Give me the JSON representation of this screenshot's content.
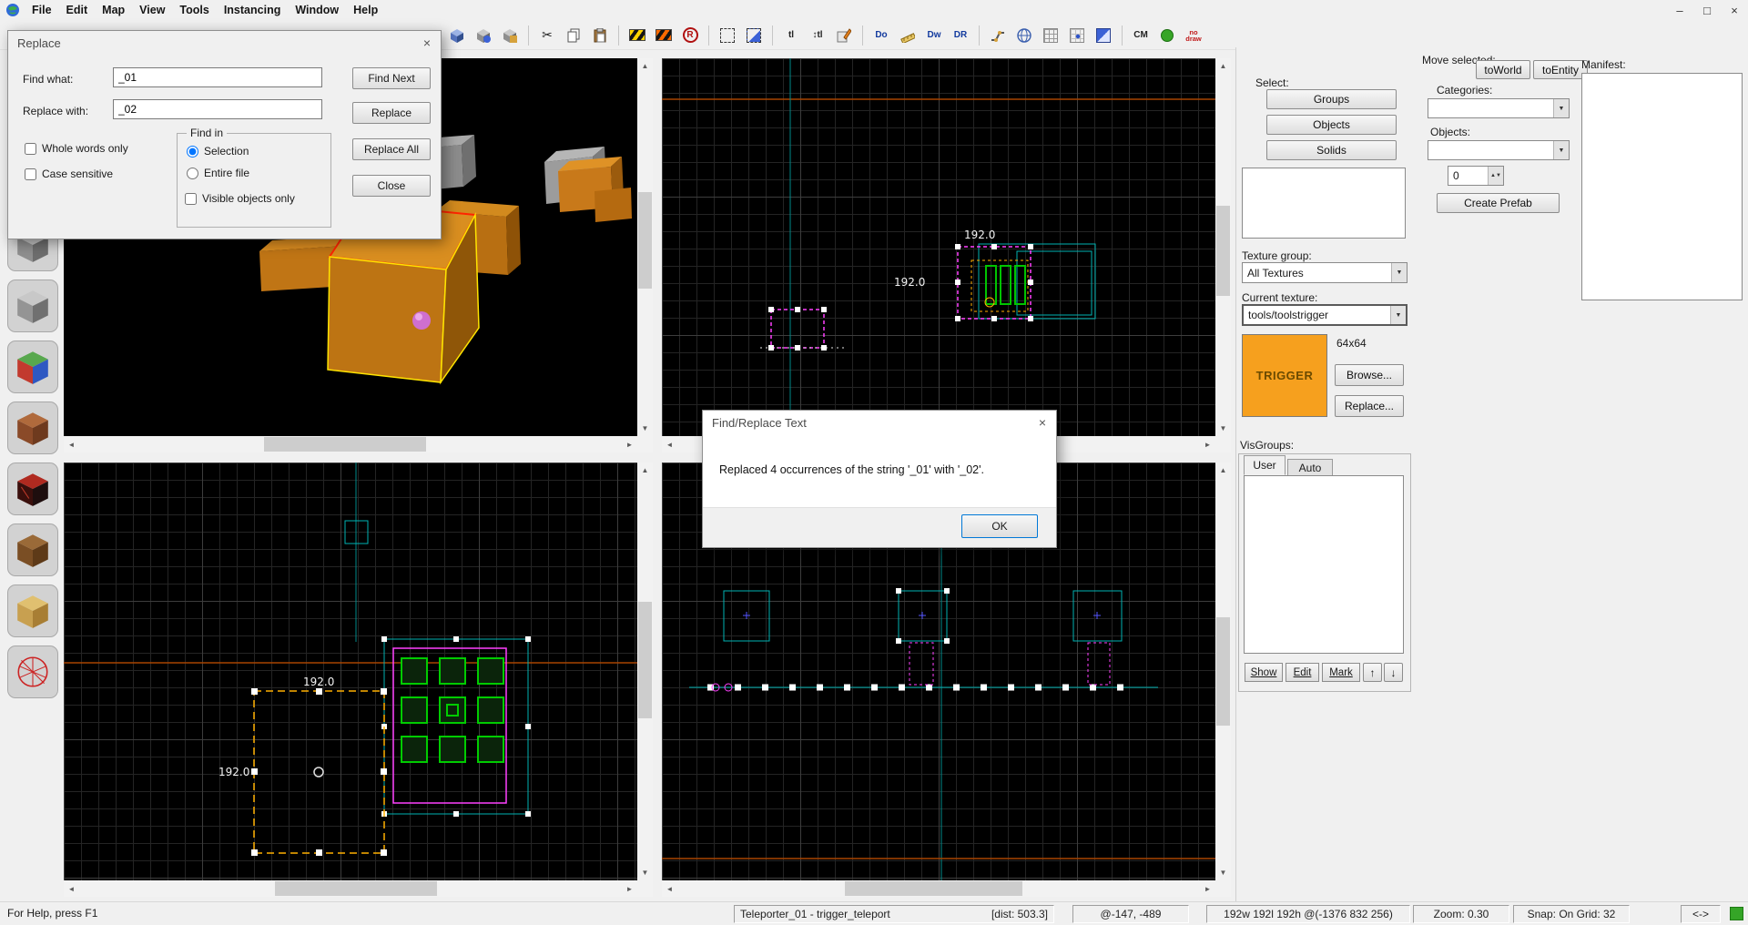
{
  "menu": {
    "items": [
      "File",
      "Edit",
      "Map",
      "View",
      "Tools",
      "Instancing",
      "Window",
      "Help"
    ]
  },
  "window_controls": {
    "minimize": "–",
    "maximize": "□",
    "close": "×"
  },
  "toolbar": {
    "texture_lock": "tl",
    "texture_scale_lock": "↕tl",
    "run_badge": "R",
    "disp_toggle_1": "Do",
    "disp_toggle_2": "Dw",
    "disp_toggle_3": "DR",
    "cm": "CM",
    "nodraw_line1": "no",
    "nodraw_line2": "draw"
  },
  "replace_dialog": {
    "title": "Replace",
    "close": "×",
    "find_label": "Find what:",
    "find_value": "_01",
    "replace_label": "Replace with:",
    "replace_value": "_02",
    "whole_words": "Whole words only",
    "case_sensitive": "Case sensitive",
    "find_in_title": "Find in",
    "radio_selection": "Selection",
    "radio_entire_file": "Entire file",
    "visible_only": "Visible objects only",
    "find_next": "Find Next",
    "replace": "Replace",
    "replace_all": "Replace All",
    "close_btn": "Close"
  },
  "message_dialog": {
    "title": "Find/Replace Text",
    "close": "×",
    "message": "Replaced 4 occurrences of the string '_01' with '_02'.",
    "ok": "OK"
  },
  "right_panel": {
    "move_selected_label": "Move selected:",
    "to_world": "toWorld",
    "to_entity": "toEntity",
    "manifest_label": "Manifest:",
    "select_label": "Select:",
    "groups": "Groups",
    "objects": "Objects",
    "solids": "Solids",
    "categories_label": "Categories:",
    "objects_label": "Objects:",
    "prefab_count": "0",
    "create_prefab": "Create Prefab",
    "texture_group_label": "Texture group:",
    "texture_group_value": "All Textures",
    "current_texture_label": "Current texture:",
    "current_texture_value": "tools/toolstrigger",
    "texture_preview_text": "TRIGGER",
    "texture_size": "64x64",
    "browse": "Browse...",
    "replace": "Replace...",
    "visgroups_label": "VisGroups:",
    "tab_user": "User",
    "tab_auto": "Auto",
    "show": "Show",
    "edit": "Edit",
    "mark": "Mark",
    "up": "↑",
    "down": "↓"
  },
  "viewport_labels": {
    "tr_width": "192.0",
    "tr_height": "192.0",
    "bl_width": "192.0",
    "bl_height": "192.0"
  },
  "status": {
    "help": "For Help, press F1",
    "selection": "Teleporter_01 - trigger_teleport",
    "dist": "[dist: 503.3]",
    "coords": "@-147, -489",
    "size": "192w 192l 192h @(-1376 832 256)",
    "zoom": "Zoom: 0.30",
    "snap": "Snap: On Grid: 32",
    "arrows": "<->"
  },
  "colors": {
    "selection_yellow": "#ffb000",
    "entity_magenta": "#ff40ff",
    "entity_teal": "#00b2b2",
    "entity_green": "#00cc00",
    "texture_orange": "#f6a01e"
  }
}
